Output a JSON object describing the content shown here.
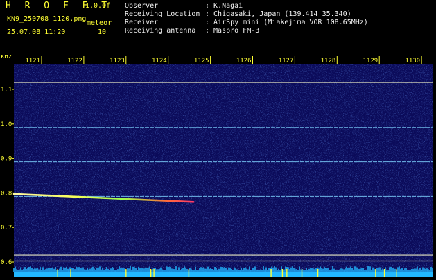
{
  "header": {
    "brand": "H R O F F T",
    "version": "1.0.0f",
    "filename": "KN9_250708 1120.png",
    "datetime": "25.07.08 11:20",
    "meteor_label": "meteor",
    "meteor_count": "10",
    "info": [
      {
        "key": "Observer",
        "value": ": K.Nagai"
      },
      {
        "key": "Receiving Location",
        "value": ": Chigasaki, Japan (139.414 35.340)"
      },
      {
        "key": "Receiver",
        "value": ": AirSpy mini (Miakejima VOR 108.65MHz)"
      },
      {
        "key": "Receiving antenna",
        "value": ": Maspro FM-3"
      }
    ]
  },
  "spectrogram": {
    "y_unit": "kHz",
    "y_ticks": [
      "1.1",
      "1.0",
      "0.9",
      "0.8",
      "0.7",
      "0.6"
    ],
    "x_ticks": [
      "1121",
      "1122",
      "1123",
      "1124",
      "1125",
      "1126",
      "1127",
      "1128",
      "1129",
      "1130"
    ],
    "colors": {
      "background": "#0b0b5a",
      "tick": "#ffff33",
      "grid": "#ffffff",
      "baseline": "#22b8ff"
    },
    "carriers_khz": [
      1.12,
      1.075,
      0.99,
      0.89,
      0.79,
      0.62,
      0.603
    ],
    "meteor_trace": {
      "start": {
        "x": 1120.0,
        "khz": 0.797
      },
      "end": {
        "x": 1124.6,
        "khz": 0.774
      }
    }
  }
}
